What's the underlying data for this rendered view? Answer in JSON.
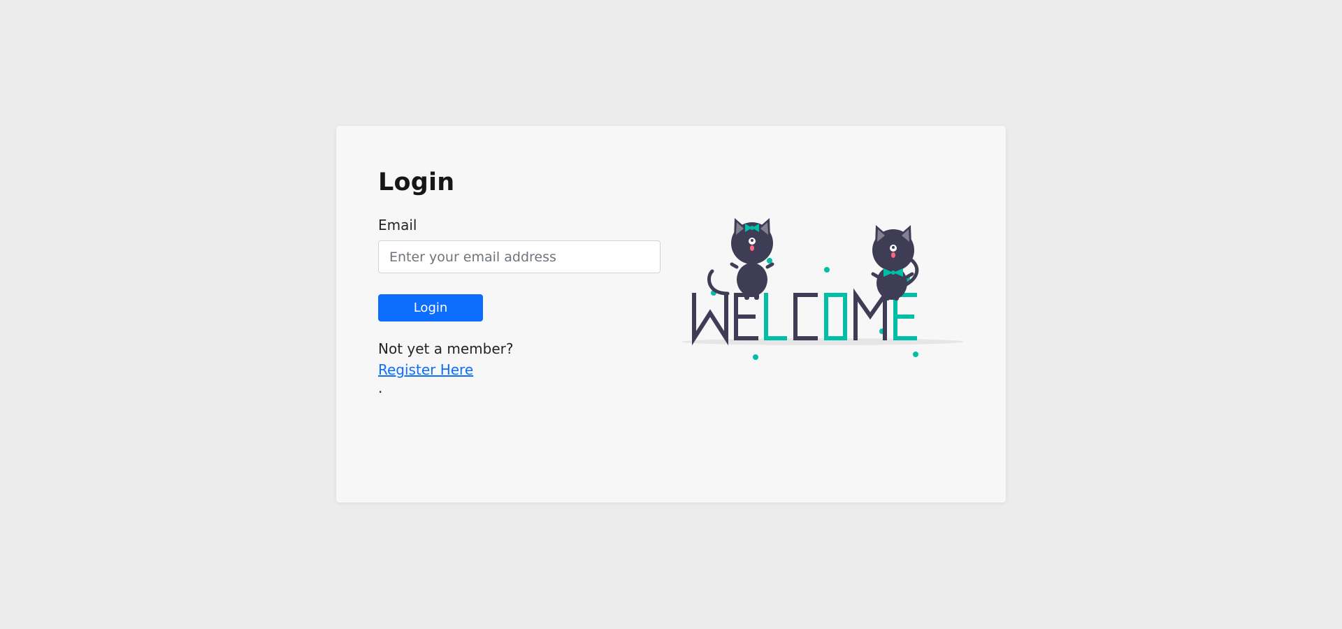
{
  "login_card": {
    "title": "Login",
    "email_label": "Email",
    "email_placeholder": "Enter your email address",
    "email_value": "",
    "login_button_label": "Login",
    "member_prompt": "Not yet a member?",
    "register_link_label": "Register Here",
    "trailing_dot": "."
  },
  "illustration": {
    "icon": "welcome-cats-illustration",
    "text_letters": [
      "W",
      "E",
      "L",
      "C",
      "O",
      "M",
      "E"
    ],
    "colors": {
      "dark": "#3f3d56",
      "accent": "#00bfa6",
      "shadow": "#e6e6e6"
    }
  },
  "colors": {
    "page_background": "#ececec",
    "card_background": "#f7f7f7",
    "primary": "#0d6efd",
    "text": "#212529"
  }
}
